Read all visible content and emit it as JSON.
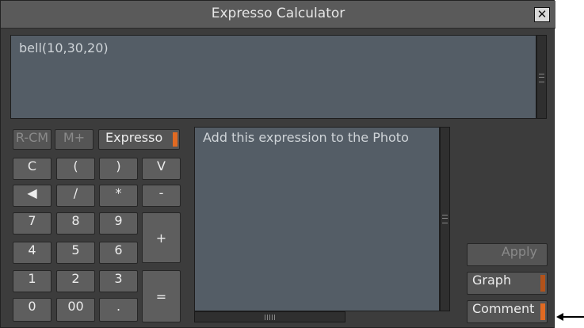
{
  "window": {
    "title": "Expresso Calculator",
    "close_symbol": "✕"
  },
  "expression": {
    "value": "bell(10,30,20)"
  },
  "comment_box": {
    "value": "Add this expression to the Photo"
  },
  "mode_buttons": {
    "rcm": "R-CM",
    "mplus": "M+",
    "expresso": "Expresso"
  },
  "keys": {
    "c": "C",
    "lparen": "(",
    "rparen": ")",
    "v": "V",
    "backspace": "◀",
    "divide": "/",
    "multiply": "*",
    "minus": "-",
    "k7": "7",
    "k8": "8",
    "k9": "9",
    "plus": "+",
    "k4": "4",
    "k5": "5",
    "k6": "6",
    "k1": "1",
    "k2": "2",
    "k3": "3",
    "equals": "=",
    "k0": "0",
    "k00": "00",
    "dot": "."
  },
  "actions": {
    "apply": "Apply",
    "graph": "Graph",
    "comment": "Comment"
  },
  "colors": {
    "accent": "#e06a22",
    "panel": "#3c3c3c",
    "field": "#545d66"
  }
}
